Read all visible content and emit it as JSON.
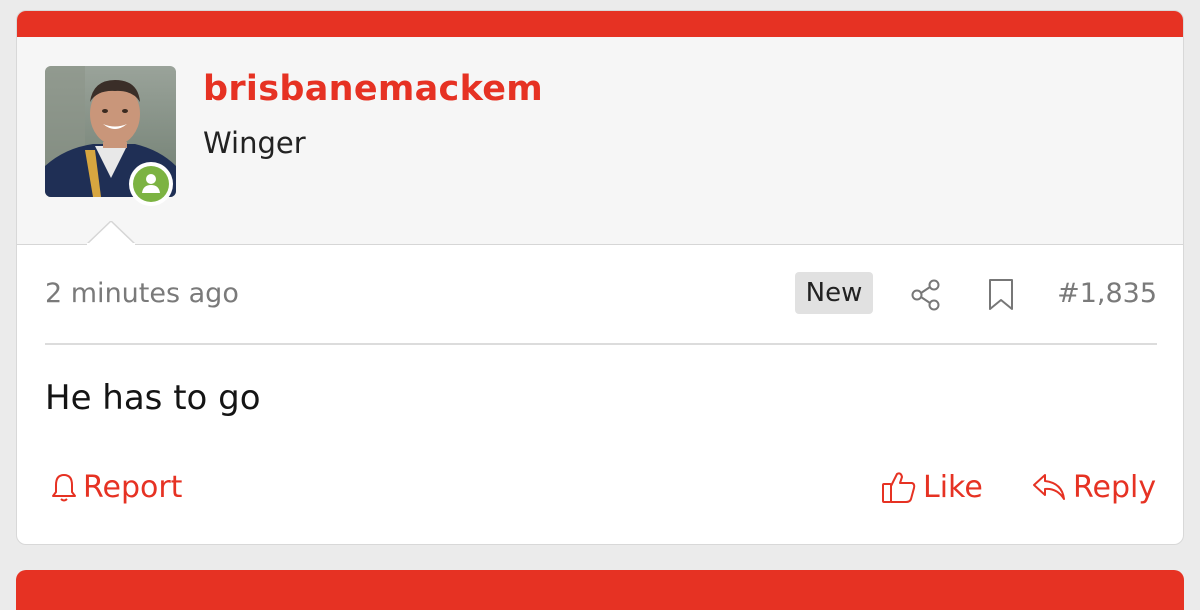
{
  "post": {
    "author": {
      "username": "brisbanemackem",
      "title": "Winger",
      "avatar_icon": "user-photo",
      "status_icon": "online-user-icon"
    },
    "timestamp": "2 minutes ago",
    "new_label": "New",
    "number": "#1,835",
    "message": "He has to go",
    "actions": {
      "report": "Report",
      "like": "Like",
      "reply": "Reply"
    }
  },
  "colors": {
    "accent": "#e63223",
    "online": "#7cb342",
    "background": "#ebebeb"
  }
}
